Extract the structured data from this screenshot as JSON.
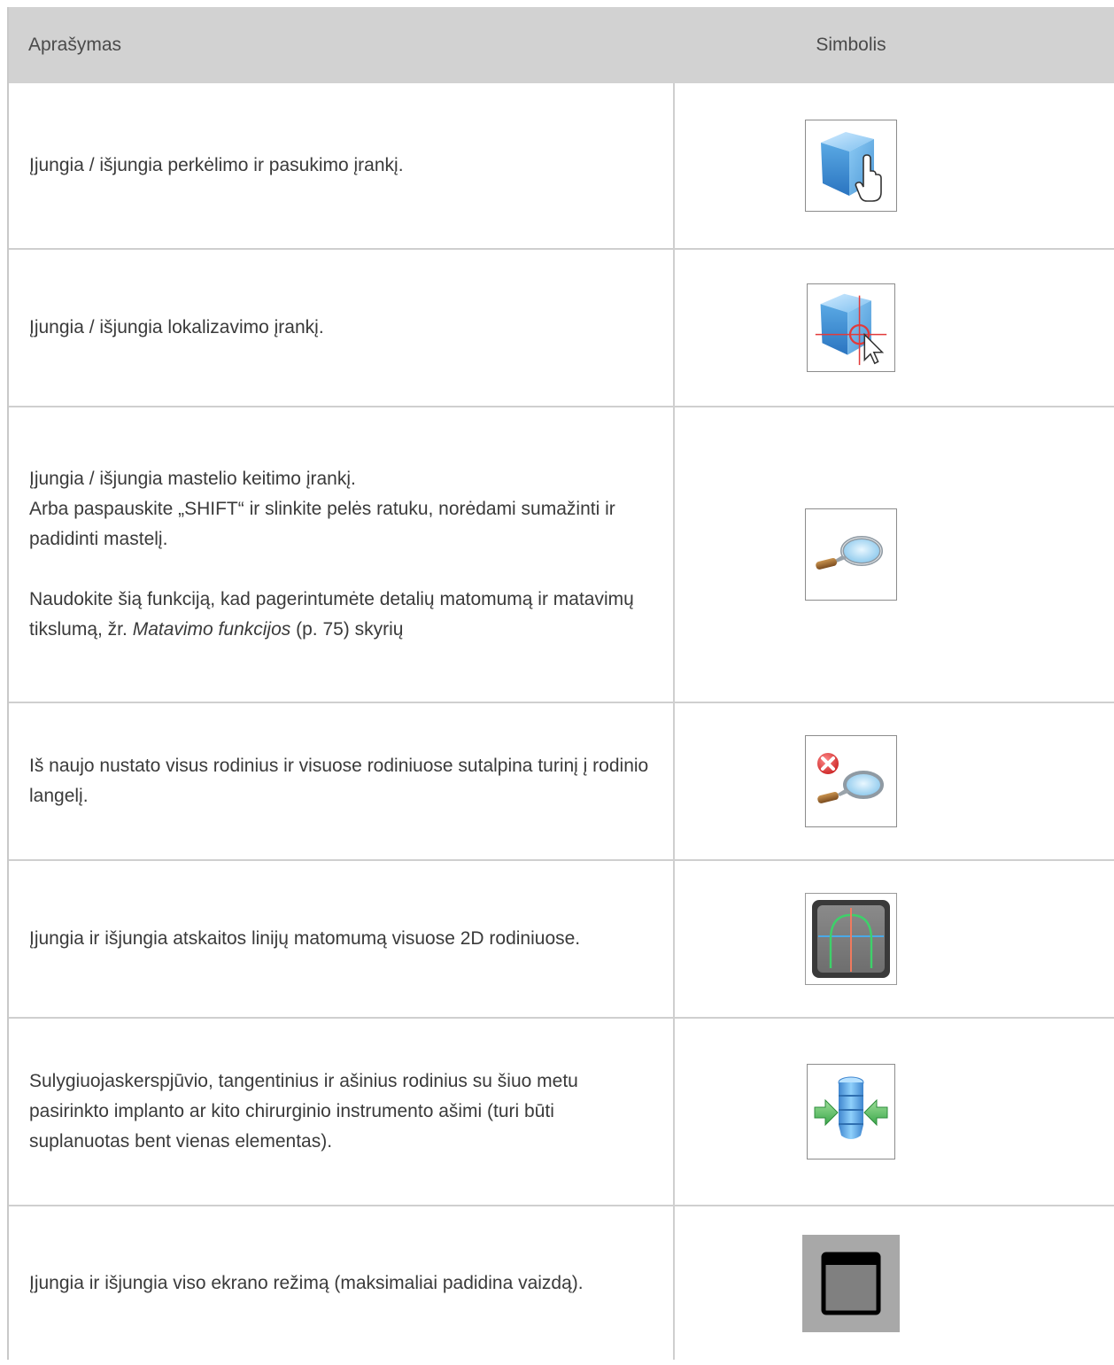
{
  "header": {
    "description_col": "Aprašymas",
    "symbol_col": "Simbolis"
  },
  "rows": [
    {
      "text": "Įjungia / išjungia perkėlimo ir pasukimo įrankį.",
      "icon": "move-rotate-cube-hand-icon"
    },
    {
      "text": "Įjungia / išjungia lokalizavimo įrankį.",
      "icon": "localize-cube-crosshair-icon"
    },
    {
      "line1": "Įjungia / išjungia mastelio keitimo įrankį.",
      "line2": "Arba paspauskite „SHIFT“ ir slinkite pelės ratuku, norėdami sumažinti ir padidinti mastelį.",
      "para2_before": "Naudokite šią funkciją, kad pagerintumėte detalių matomumą ir matavimų tikslumą, žr. ",
      "para2_link": "Matavimo funkcijos",
      "para2_after": " (p. 75) skyrių",
      "icon": "zoom-magnifier-icon"
    },
    {
      "text": "Iš naujo nustato visus rodinius ir visuose rodiniuose sutalpina turinį į rodinio langelį.",
      "icon": "reset-zoom-magnifier-icon"
    },
    {
      "text": "Įjungia ir išjungia atskaitos linijų matomumą visuose 2D rodiniuose.",
      "icon": "reference-lines-icon"
    },
    {
      "text": "Sulygiuojaskerspjūvio, tangentinius ir ašinius rodinius su šiuo metu pasirinkto implanto ar kito chirurginio instrumento ašimi (turi būti suplanuotas bent vienas elementas).",
      "icon": "align-implant-axis-icon"
    },
    {
      "text": "Įjungia ir išjungia  viso ekrano režimą (maksimaliai padidina vaizdą).",
      "icon": "fullscreen-window-icon"
    }
  ]
}
